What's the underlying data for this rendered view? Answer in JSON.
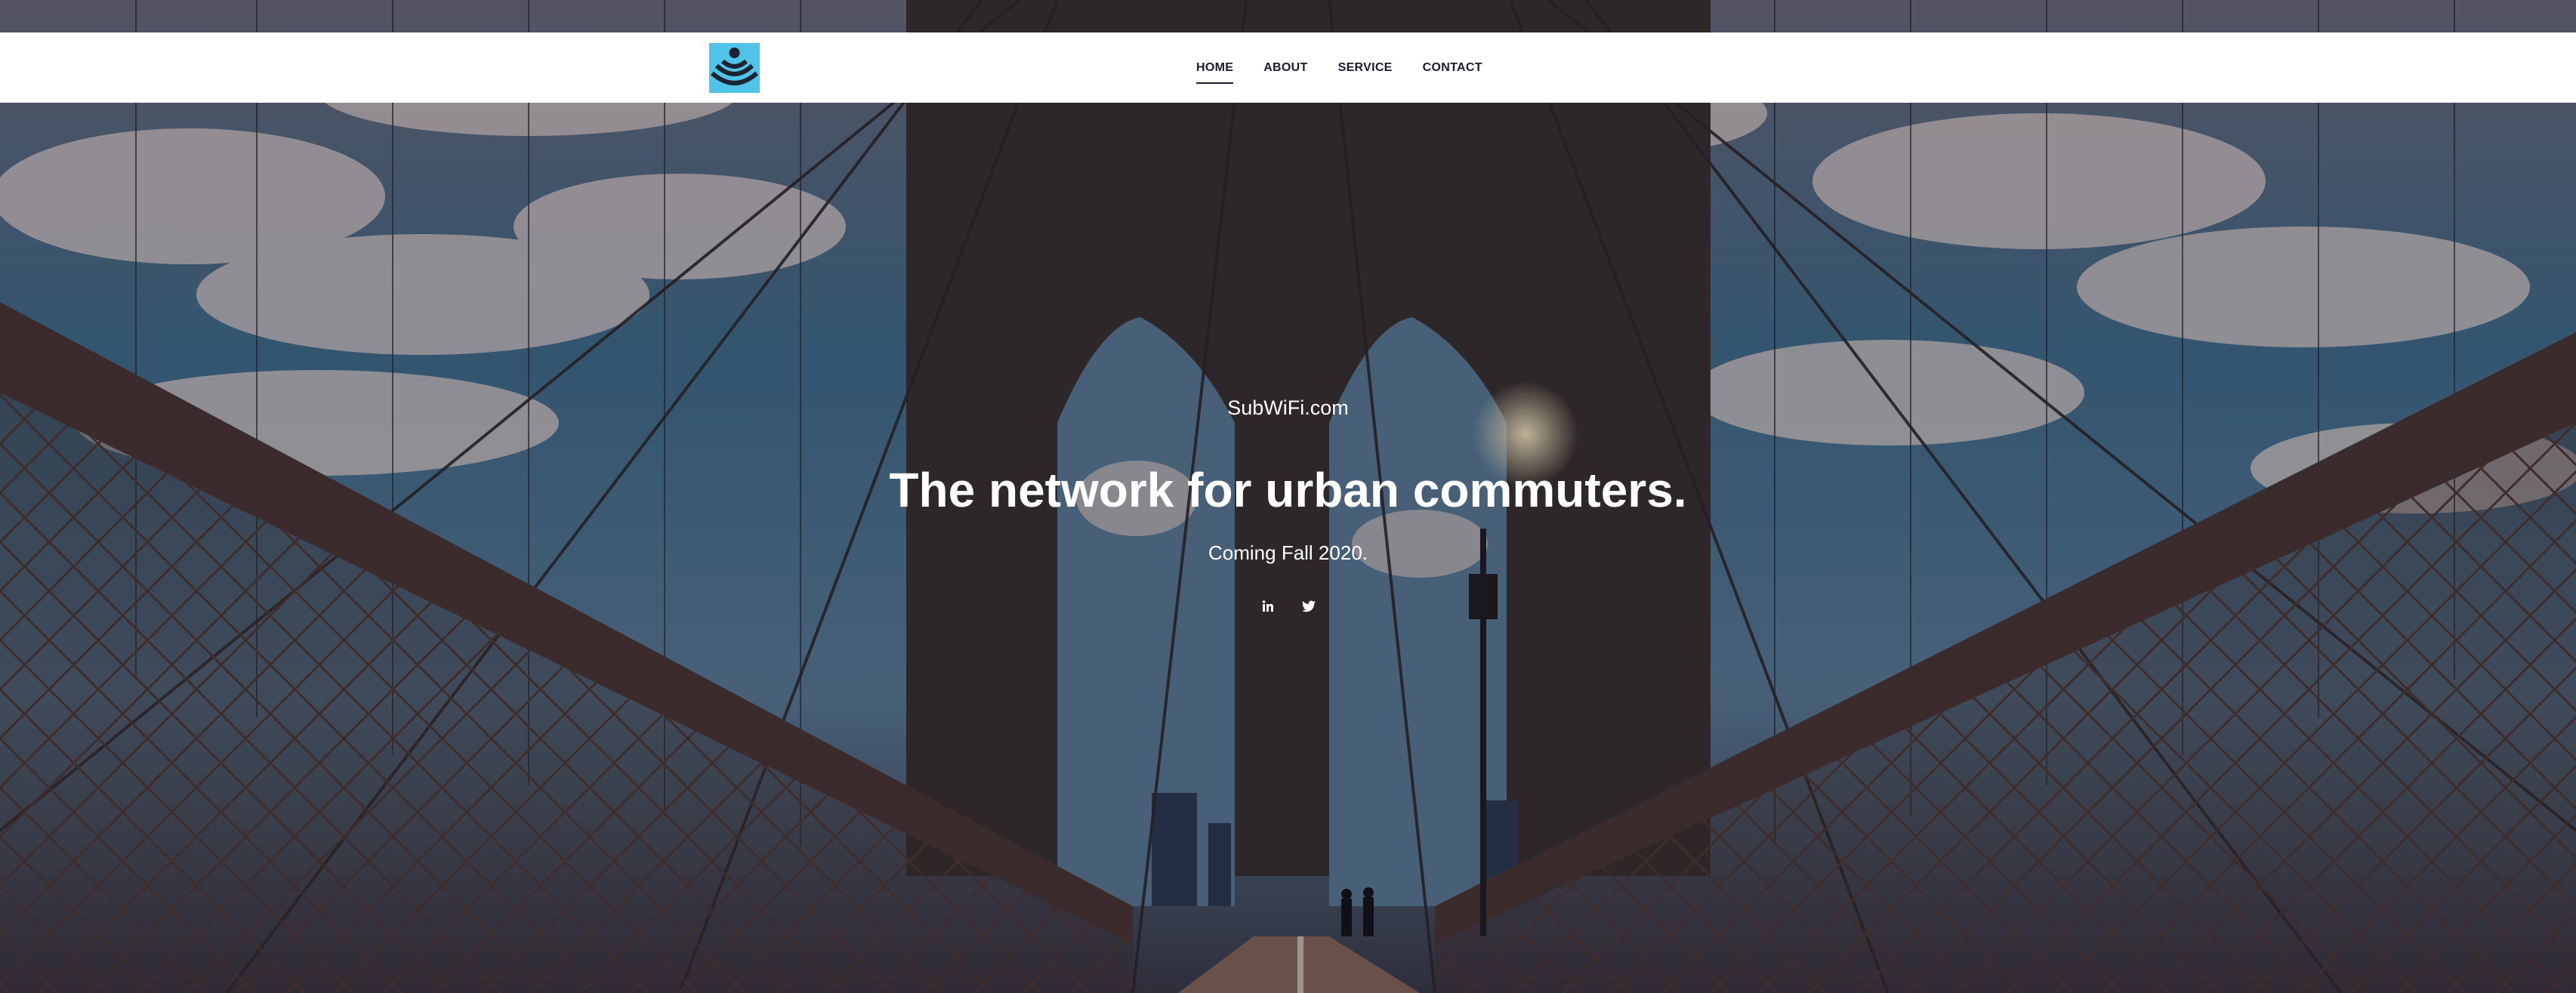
{
  "brand": {
    "logo_icon": "wifi-person-icon",
    "logo_color": "#4fc3e8"
  },
  "nav": {
    "items": [
      {
        "label": "HOME",
        "active": true
      },
      {
        "label": "ABOUT",
        "active": false
      },
      {
        "label": "SERVICE",
        "active": false
      },
      {
        "label": "CONTACT",
        "active": false
      }
    ]
  },
  "hero": {
    "site_name": "SubWiFi.com",
    "headline": "The network for urban commuters.",
    "tagline": "Coming Fall 2020.",
    "social": [
      {
        "icon": "linkedin-icon"
      },
      {
        "icon": "twitter-icon"
      }
    ]
  },
  "colors": {
    "nav_background": "#ffffff",
    "nav_text": "#1b1b2e",
    "hero_text": "#ffffff"
  }
}
